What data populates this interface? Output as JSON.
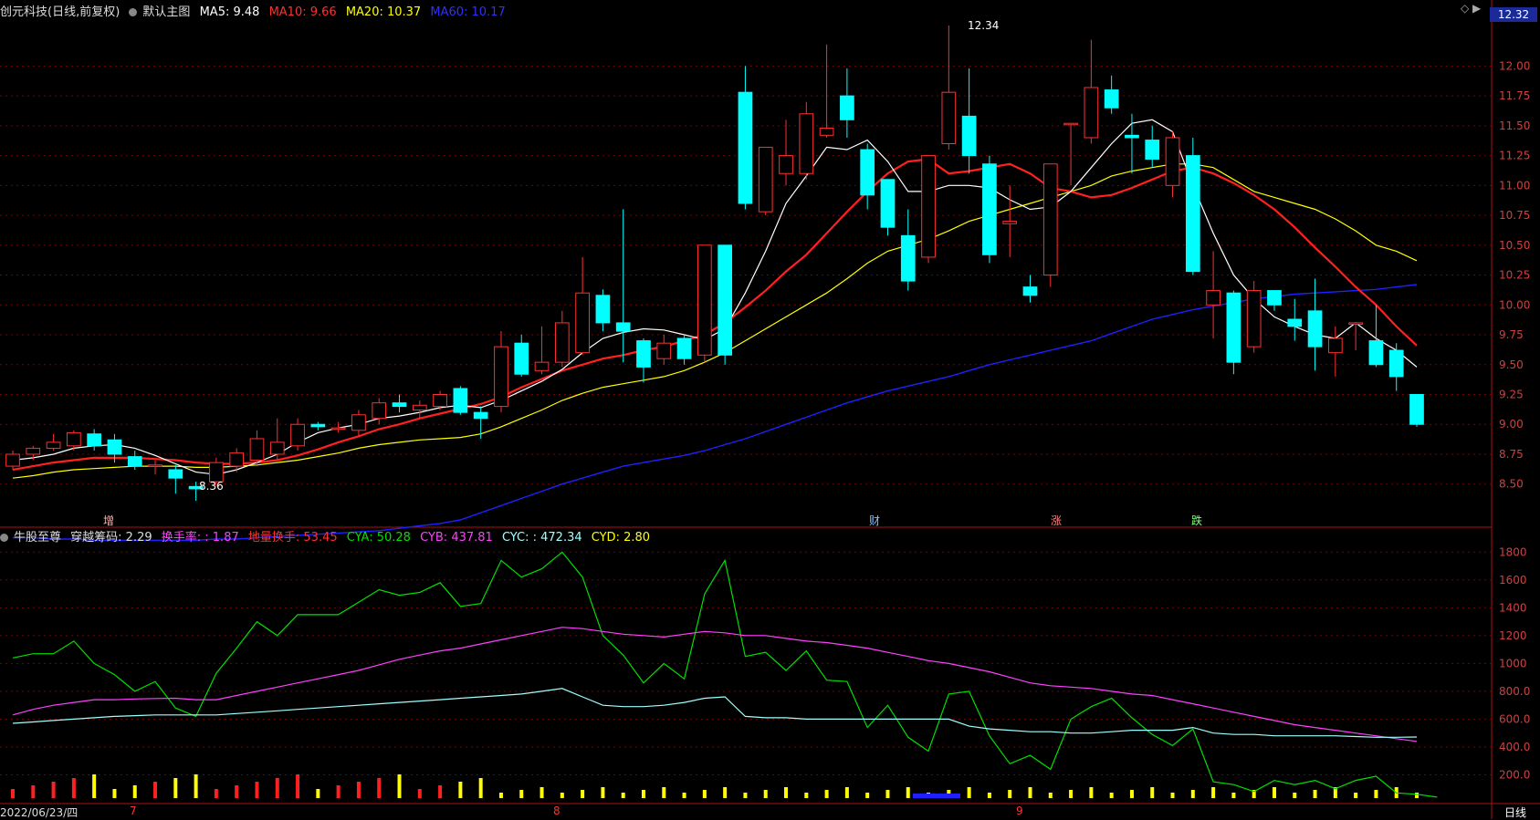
{
  "header": {
    "stock": "创元科技(日线,前复权)",
    "main_label": "默认主图",
    "ma5": "MA5: 9.48",
    "ma10": "MA10: 9.66",
    "ma20": "MA20: 10.37",
    "ma60": "MA60: 10.17",
    "price_tag": "12.32",
    "sub_label": "牛股至尊",
    "chip": "穿越筹码: 2.29",
    "hsl": "换手率: : 1.87",
    "dlhs": "地量换手: 53.45",
    "cya": "CYA: 50.28",
    "cyb": "CYB: 437.81",
    "cyc": "CYC: : 472.34",
    "cyd": "CYD: 2.80"
  },
  "footer": {
    "date": "2022/06/23/四",
    "months": [
      "7",
      "8",
      "9"
    ],
    "period": "日线"
  },
  "annotations": {
    "high": "12.34",
    "low": "8.36",
    "events": [
      "增",
      "财",
      "涨",
      "跌"
    ]
  },
  "colors": {
    "up": "#ff3030",
    "down": "#00ffff",
    "ma5": "#ffffff",
    "ma10": "#ff2020",
    "ma20": "#ffff00",
    "ma60": "#2020ff",
    "cya": "#00e000",
    "cyb": "#ff40ff",
    "cyc": "#a0ffff"
  },
  "chart_data": [
    {
      "type": "candlestick",
      "ylim": [
        8.2,
        12.4
      ],
      "yticks": [
        "12.00",
        "11.75",
        "11.50",
        "11.25",
        "11.00",
        "10.75",
        "10.50",
        "10.25",
        "10.00",
        "9.75",
        "9.50",
        "9.25",
        "9.00",
        "8.75",
        "8.50"
      ],
      "ohlc": [
        [
          8.65,
          8.78,
          8.62,
          8.75
        ],
        [
          8.75,
          8.82,
          8.7,
          8.8
        ],
        [
          8.8,
          8.92,
          8.78,
          8.85
        ],
        [
          8.82,
          8.95,
          8.78,
          8.93
        ],
        [
          8.92,
          8.96,
          8.78,
          8.82
        ],
        [
          8.87,
          8.92,
          8.68,
          8.75
        ],
        [
          8.73,
          8.78,
          8.62,
          8.65
        ],
        [
          8.65,
          8.7,
          8.58,
          8.66
        ],
        [
          8.62,
          8.66,
          8.42,
          8.55
        ],
        [
          8.48,
          8.52,
          8.36,
          8.46
        ],
        [
          8.52,
          8.72,
          8.48,
          8.68
        ],
        [
          8.65,
          8.8,
          8.6,
          8.76
        ],
        [
          8.7,
          8.95,
          8.65,
          8.88
        ],
        [
          8.75,
          9.05,
          8.7,
          8.85
        ],
        [
          8.82,
          9.05,
          8.78,
          9.0
        ],
        [
          9.0,
          9.02,
          8.95,
          8.98
        ],
        [
          8.97,
          9.02,
          8.93,
          8.97
        ],
        [
          8.95,
          9.12,
          8.9,
          9.08
        ],
        [
          9.05,
          9.22,
          9.0,
          9.18
        ],
        [
          9.18,
          9.25,
          9.1,
          9.15
        ],
        [
          9.12,
          9.2,
          9.05,
          9.16
        ],
        [
          9.15,
          9.28,
          9.12,
          9.25
        ],
        [
          9.3,
          9.32,
          9.08,
          9.1
        ],
        [
          9.1,
          9.15,
          8.88,
          9.05
        ],
        [
          9.15,
          9.78,
          9.1,
          9.65
        ],
        [
          9.68,
          9.75,
          9.4,
          9.42
        ],
        [
          9.45,
          9.82,
          9.42,
          9.52
        ],
        [
          9.52,
          9.95,
          9.48,
          9.85
        ],
        [
          9.6,
          10.4,
          9.58,
          10.1
        ],
        [
          10.08,
          10.13,
          9.78,
          9.85
        ],
        [
          9.85,
          10.8,
          9.52,
          9.78
        ],
        [
          9.7,
          9.72,
          9.35,
          9.48
        ],
        [
          9.55,
          9.75,
          9.5,
          9.68
        ],
        [
          9.72,
          9.75,
          9.5,
          9.55
        ],
        [
          9.58,
          10.05,
          9.52,
          10.5
        ],
        [
          10.5,
          10.5,
          9.5,
          9.58
        ],
        [
          11.78,
          12.0,
          10.8,
          10.85
        ],
        [
          10.78,
          11.3,
          10.75,
          11.32
        ],
        [
          11.1,
          11.55,
          11.0,
          11.25
        ],
        [
          11.1,
          11.7,
          11.05,
          11.6
        ],
        [
          11.42,
          12.18,
          11.4,
          11.48
        ],
        [
          11.75,
          11.98,
          11.4,
          11.55
        ],
        [
          11.3,
          11.35,
          10.8,
          10.92
        ],
        [
          11.05,
          11.05,
          10.58,
          10.65
        ],
        [
          10.58,
          10.8,
          10.12,
          10.2
        ],
        [
          10.4,
          11.25,
          10.35,
          11.25
        ],
        [
          11.35,
          12.34,
          11.3,
          11.78
        ],
        [
          11.58,
          11.98,
          11.1,
          11.25
        ],
        [
          11.18,
          11.25,
          10.35,
          10.42
        ],
        [
          10.68,
          11.0,
          10.4,
          10.7
        ],
        [
          10.15,
          10.25,
          10.02,
          10.08
        ],
        [
          10.25,
          11.18,
          10.15,
          11.18
        ],
        [
          11.52,
          11.52,
          11.0,
          11.52
        ],
        [
          11.4,
          12.22,
          11.35,
          11.82
        ],
        [
          11.8,
          11.92,
          11.6,
          11.65
        ],
        [
          11.42,
          11.6,
          11.1,
          11.4
        ],
        [
          11.38,
          11.5,
          11.15,
          11.22
        ],
        [
          11.0,
          11.45,
          10.9,
          11.4
        ],
        [
          11.25,
          11.4,
          10.25,
          10.28
        ],
        [
          10.0,
          10.45,
          9.72,
          10.12
        ],
        [
          10.1,
          10.12,
          9.42,
          9.52
        ],
        [
          9.65,
          10.2,
          9.6,
          10.12
        ],
        [
          10.12,
          10.12,
          9.95,
          10.0
        ],
        [
          9.88,
          10.05,
          9.7,
          9.82
        ],
        [
          9.95,
          10.22,
          9.45,
          9.65
        ],
        [
          9.6,
          9.82,
          9.4,
          9.72
        ],
        [
          9.85,
          9.85,
          9.62,
          9.85
        ],
        [
          9.7,
          10.0,
          9.48,
          9.5
        ],
        [
          9.62,
          9.68,
          9.28,
          9.4
        ],
        [
          9.25,
          9.25,
          8.98,
          9.0
        ]
      ],
      "ma5": [
        8.7,
        8.72,
        8.75,
        8.8,
        8.82,
        8.83,
        8.8,
        8.74,
        8.67,
        8.6,
        8.58,
        8.62,
        8.68,
        8.75,
        8.85,
        8.93,
        8.97,
        9.0,
        9.05,
        9.07,
        9.1,
        9.14,
        9.16,
        9.14,
        9.2,
        9.28,
        9.36,
        9.46,
        9.6,
        9.72,
        9.77,
        9.8,
        9.79,
        9.75,
        9.71,
        9.8,
        10.1,
        10.45,
        10.85,
        11.08,
        11.32,
        11.3,
        11.38,
        11.2,
        10.95,
        10.95,
        11.0,
        11.0,
        10.98,
        10.88,
        10.8,
        10.82,
        10.95,
        11.15,
        11.35,
        11.52,
        11.55,
        11.45,
        11.0,
        10.6,
        10.25,
        10.05,
        9.9,
        9.82,
        9.75,
        9.72,
        9.85,
        9.72,
        9.62,
        9.48
      ],
      "ma10": [
        8.62,
        8.65,
        8.68,
        8.7,
        8.72,
        8.72,
        8.72,
        8.71,
        8.7,
        8.68,
        8.67,
        8.67,
        8.68,
        8.7,
        8.74,
        8.79,
        8.85,
        8.9,
        8.96,
        9.0,
        9.05,
        9.09,
        9.13,
        9.17,
        9.23,
        9.31,
        9.38,
        9.45,
        9.5,
        9.55,
        9.58,
        9.62,
        9.65,
        9.7,
        9.75,
        9.85,
        9.98,
        10.12,
        10.28,
        10.42,
        10.6,
        10.78,
        10.95,
        11.1,
        11.2,
        11.22,
        11.1,
        11.12,
        11.15,
        11.18,
        11.1,
        10.98,
        10.95,
        10.9,
        10.92,
        10.98,
        11.05,
        11.12,
        11.15,
        11.1,
        11.02,
        10.92,
        10.8,
        10.65,
        10.48,
        10.32,
        10.15,
        10.0,
        9.82,
        9.66
      ],
      "ma20": [
        8.55,
        8.57,
        8.6,
        8.62,
        8.63,
        8.64,
        8.65,
        8.65,
        8.65,
        8.64,
        8.64,
        8.65,
        8.66,
        8.68,
        8.7,
        8.73,
        8.76,
        8.8,
        8.83,
        8.85,
        8.87,
        8.88,
        8.89,
        8.92,
        8.98,
        9.05,
        9.12,
        9.2,
        9.26,
        9.31,
        9.34,
        9.37,
        9.4,
        9.45,
        9.52,
        9.6,
        9.7,
        9.8,
        9.9,
        10.0,
        10.1,
        10.22,
        10.35,
        10.45,
        10.5,
        10.55,
        10.62,
        10.7,
        10.75,
        10.8,
        10.85,
        10.9,
        10.95,
        11.0,
        11.08,
        11.12,
        11.15,
        11.18,
        11.18,
        11.15,
        11.05,
        10.95,
        10.9,
        10.85,
        10.8,
        10.72,
        10.62,
        10.5,
        10.45,
        10.37
      ],
      "ma60": [
        8.05,
        8.05,
        8.04,
        8.04,
        8.03,
        8.03,
        8.03,
        8.03,
        8.03,
        8.03,
        8.04,
        8.04,
        8.05,
        8.06,
        8.07,
        8.08,
        8.09,
        8.1,
        8.11,
        8.13,
        8.15,
        8.17,
        8.2,
        8.26,
        8.32,
        8.38,
        8.44,
        8.5,
        8.55,
        8.6,
        8.65,
        8.68,
        8.71,
        8.74,
        8.78,
        8.83,
        8.88,
        8.94,
        9.0,
        9.06,
        9.12,
        9.18,
        9.23,
        9.28,
        9.32,
        9.36,
        9.4,
        9.45,
        9.5,
        9.54,
        9.58,
        9.62,
        9.66,
        9.7,
        9.76,
        9.82,
        9.88,
        9.92,
        9.96,
        9.99,
        10.02,
        10.05,
        10.07,
        10.09,
        10.1,
        10.11,
        10.12,
        10.13,
        10.15,
        10.17
      ]
    },
    {
      "type": "line",
      "ylim": [
        0,
        1900
      ],
      "yticks": [
        "1800",
        "1600",
        "1400",
        "1200",
        "1000",
        "800.0",
        "600.0",
        "400.0",
        "200.0"
      ],
      "series": [
        {
          "name": "CYA",
          "values": [
            1040,
            1070,
            1070,
            1160,
            1000,
            920,
            800,
            870,
            680,
            620,
            930,
            1110,
            1300,
            1200,
            1350,
            1350,
            1350,
            1440,
            1530,
            1490,
            1510,
            1580,
            1410,
            1430,
            1740,
            1620,
            1680,
            1800,
            1620,
            1200,
            1060,
            860,
            1000,
            890,
            1500,
            1740,
            1050,
            1080,
            950,
            1090,
            880,
            870,
            540,
            700,
            470,
            370,
            780,
            800,
            480,
            280,
            340,
            240,
            600,
            690,
            750,
            610,
            490,
            410,
            530,
            150,
            130,
            80,
            160,
            130,
            160,
            100,
            160,
            190,
            70,
            60,
            40
          ]
        },
        {
          "name": "CYB",
          "values": [
            630,
            670,
            700,
            720,
            740,
            740,
            745,
            748,
            750,
            740,
            740,
            770,
            800,
            830,
            860,
            890,
            920,
            950,
            990,
            1030,
            1060,
            1090,
            1110,
            1140,
            1170,
            1200,
            1230,
            1260,
            1250,
            1230,
            1210,
            1200,
            1190,
            1210,
            1230,
            1220,
            1200,
            1200,
            1180,
            1160,
            1150,
            1130,
            1110,
            1080,
            1050,
            1020,
            1000,
            970,
            940,
            900,
            860,
            840,
            830,
            820,
            800,
            780,
            770,
            740,
            710,
            680,
            650,
            620,
            590,
            560,
            540,
            520,
            500,
            480,
            460,
            440
          ]
        },
        {
          "name": "CYC",
          "values": [
            570,
            580,
            590,
            600,
            610,
            620,
            625,
            630,
            630,
            630,
            630,
            640,
            650,
            660,
            670,
            680,
            690,
            700,
            710,
            720,
            730,
            740,
            750,
            760,
            770,
            780,
            800,
            820,
            760,
            700,
            690,
            690,
            700,
            720,
            750,
            760,
            620,
            610,
            610,
            600,
            600,
            600,
            600,
            600,
            600,
            600,
            600,
            550,
            530,
            520,
            510,
            510,
            500,
            500,
            510,
            520,
            520,
            520,
            540,
            500,
            490,
            490,
            480,
            480,
            480,
            480,
            475,
            470,
            470,
            472
          ]
        }
      ]
    }
  ]
}
